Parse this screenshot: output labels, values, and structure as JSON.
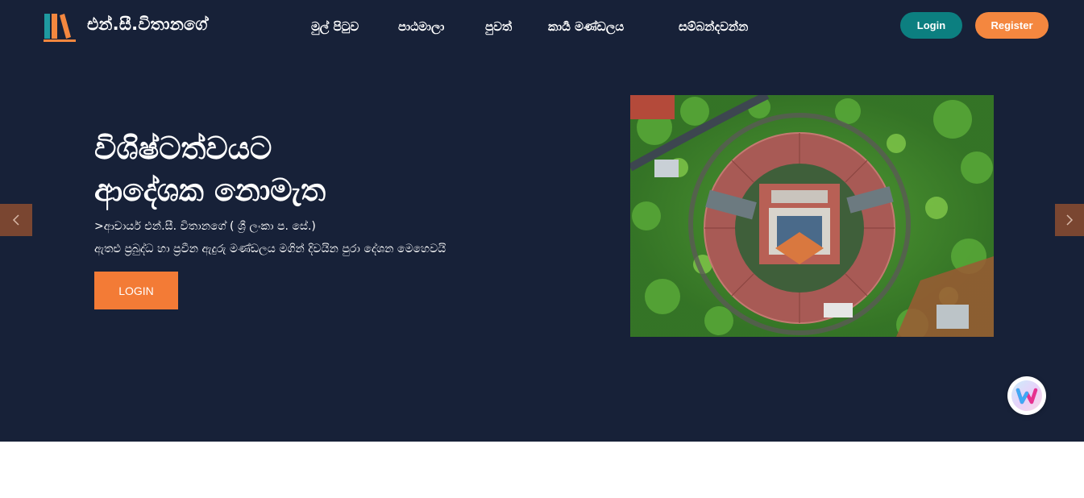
{
  "header": {
    "brand": "එන්.සී.විතානගේ",
    "logo_icon": "books-icon",
    "nav": [
      "මුල් පිටුව",
      "පාඨමාලා",
      "පුවත්",
      "කාර්‍ය මණ්ඩලය",
      "සම්බන්දවන්න"
    ],
    "login_label": "Login",
    "register_label": "Register"
  },
  "hero": {
    "headline_line1": "විශිෂ්ටත්වයට",
    "headline_line2": "ආදේශක නොමැත",
    "subtitle": ">ආචාර්ය එන්.සී. විතානගේ ( ශ්‍රී ලංකා ප. සේ.)",
    "description": "ඇතළු ප්‍රබුද්ධ හා ප්‍රවීන ඇදුරු මණ්ඩලය මගින් දිවයින පුරා දේශන මෙහෙවයි",
    "cta_label": "LOGIN",
    "image_subject": "aerial-campus-building-photo",
    "prev_icon": "chevron-left-icon",
    "next_icon": "chevron-right-icon"
  },
  "widget": {
    "icon": "w-chat-widget-icon"
  },
  "colors": {
    "background": "#172138",
    "teal": "#0c7f80",
    "orange": "#f4873f",
    "cta": "#f37b36",
    "arrow": "#7a4631"
  }
}
